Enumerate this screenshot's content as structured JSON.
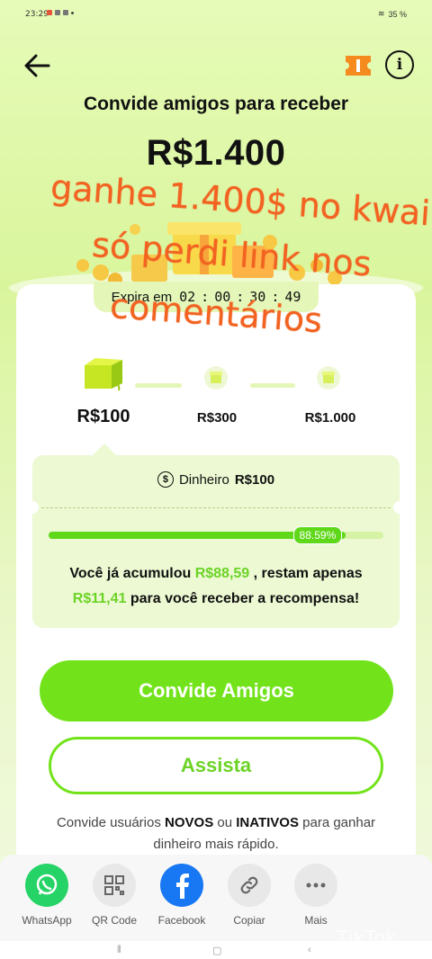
{
  "status_bar": {
    "time": "23:29",
    "battery": "35 %"
  },
  "header": {
    "subtitle": "Convide amigos para receber",
    "amount": "R$1.400"
  },
  "expira": {
    "label": "Expira em",
    "hours": "02",
    "minutes": "00",
    "seconds": "30",
    "fraction": "49",
    "sep": ":"
  },
  "steps": [
    {
      "label": "R$100"
    },
    {
      "label": "R$300"
    },
    {
      "label": "R$1.000"
    }
  ],
  "reward": {
    "label": "Dinheiro",
    "value": "R$100",
    "progress_percent": 88.59,
    "progress_text": "88.59%",
    "text_1": "Você já acumulou",
    "accumulated": "R$88,59",
    "text_2": ", restam apenas",
    "remaining": "R$11,41",
    "text_3": "para você receber a recompensa!"
  },
  "buttons": {
    "invite": "Convide Amigos",
    "watch": "Assista"
  },
  "hint": {
    "p1": "Convide usuários",
    "novos": "NOVOS",
    "p2": "ou",
    "inativos": "INATIVOS",
    "p3": "para ganhar dinheiro mais rápido."
  },
  "share": [
    {
      "label": "WhatsApp",
      "icon": "whatsapp-icon",
      "color": "#25d366"
    },
    {
      "label": "QR Code",
      "icon": "qr-code-icon",
      "color": "#e8e8e8"
    },
    {
      "label": "Facebook",
      "icon": "facebook-icon",
      "color": "#1877f2"
    },
    {
      "label": "Copiar",
      "icon": "link-icon",
      "color": "#e8e8e8"
    },
    {
      "label": "Mais",
      "icon": "more-icon",
      "color": "#e8e8e8"
    }
  ],
  "overlay": {
    "line1": "ganhe 1.400$ no kwai",
    "line2": "só perdi link nos",
    "line3": "comentários",
    "color": "#f26322"
  },
  "watermark": "TikTok",
  "colors": {
    "accent": "#72e31b",
    "accent_text": "#6cd326",
    "background": "#e6fbb8"
  }
}
